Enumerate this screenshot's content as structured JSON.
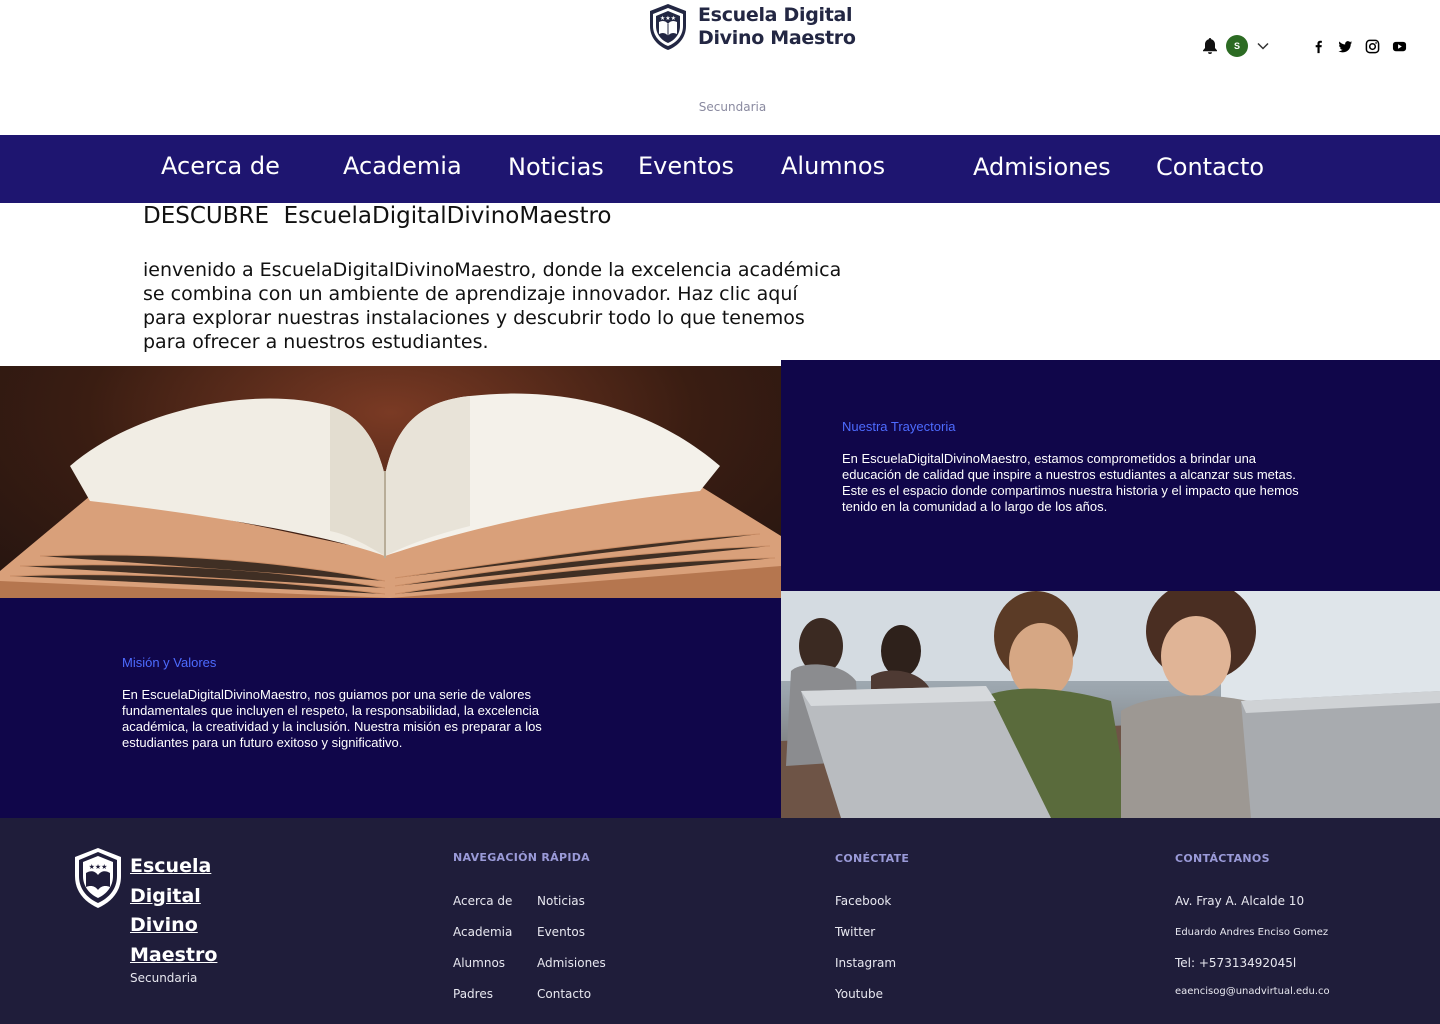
{
  "header": {
    "logo_line1": "Escuela Digital",
    "logo_line2": "Divino Maestro",
    "subtitle": "Secundaria",
    "avatar_initial": "S",
    "icons": [
      "bell-icon",
      "chevron-down-icon"
    ],
    "social_icons": [
      "facebook-icon",
      "twitter-icon",
      "instagram-icon",
      "youtube-icon"
    ]
  },
  "nav": {
    "items": [
      "Acerca de",
      "Academia",
      "Noticias",
      "Eventos",
      "Alumnos",
      "Admisiones",
      "Contacto"
    ]
  },
  "intro": {
    "title": "DESCUBRE  EscuelaDigitalDivinoMaestro",
    "text": "ienvenido a EscuelaDigitalDivinoMaestro, donde la excelencia académica se combina con un ambiente de aprendizaje innovador. Haz clic aquí para explorar nuestras instalaciones y descubrir todo lo que tenemos para ofrecer a nuestros estudiantes."
  },
  "trayectoria": {
    "heading": "Nuestra Trayectoria",
    "text": "En EscuelaDigitalDivinoMaestro, estamos comprometidos a brindar una educación de calidad que inspire a nuestros estudiantes a alcanzar sus metas. Este es el espacio donde compartimos nuestra historia y el impacto que hemos tenido en la comunidad a lo largo de los años."
  },
  "mision": {
    "heading": "Misión y Valores",
    "text": "En EscuelaDigitalDivinoMaestro, nos guiamos por una serie de valores fundamentales que incluyen el respeto, la responsabilidad, la excelencia académica, la creatividad y la inclusión. Nuestra misión es preparar a los estudiantes para un futuro exitoso y significativo."
  },
  "footer": {
    "logo_lines": [
      "Escuela",
      "Digital",
      "Divino",
      "Maestro"
    ],
    "logo_sub": "Secundaria",
    "nav_heading": "NAVEGACIÓN RÁPIDA",
    "nav_col1": [
      "Acerca de",
      "Academia",
      "Alumnos",
      "Padres"
    ],
    "nav_col2": [
      "Noticias",
      "Eventos",
      "Admisiones",
      "Contacto"
    ],
    "connect_heading": "CONÉCTATE",
    "connect_links": [
      "Facebook",
      "Twitter",
      "Instagram",
      "Youtube"
    ],
    "contact_heading": "CONTÁCTANOS",
    "address": "Av. Fray A. Alcalde 10",
    "name": "Eduardo Andres Enciso Gomez",
    "phone": "Tel: +57313492045l",
    "email": "eaencisog@unadvirtual.edu.co"
  },
  "colors": {
    "nav_bg": "#1e1570",
    "panel_bg": "#10064a",
    "footer_bg": "#1f1d3a",
    "accent_heading": "#4d6bff"
  }
}
